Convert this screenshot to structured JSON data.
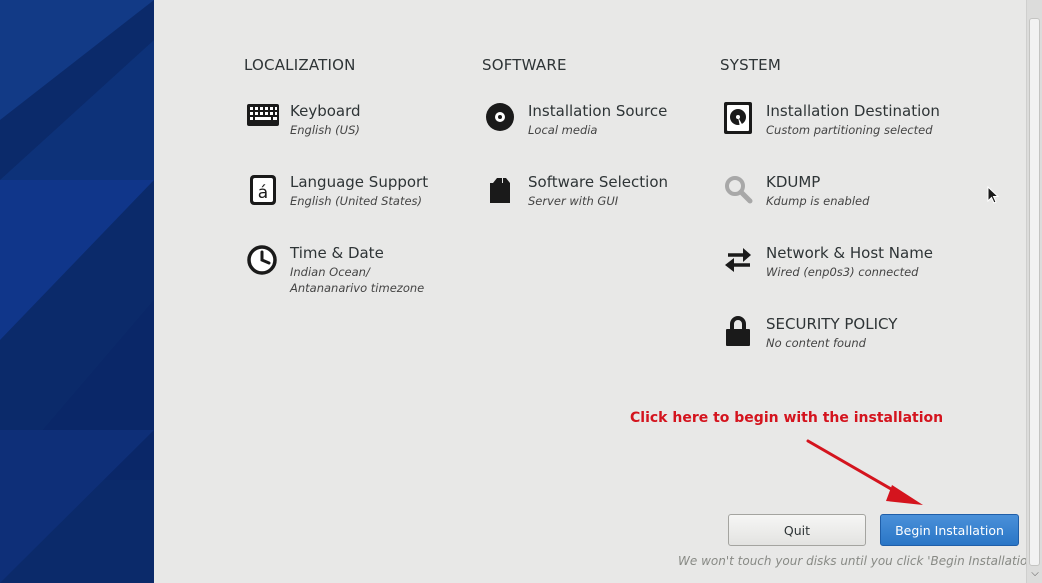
{
  "columns": {
    "localization": {
      "title": "LOCALIZATION",
      "items": [
        {
          "title": "Keyboard",
          "status": "English (US)",
          "icon": "keyboard-icon"
        },
        {
          "title": "Language Support",
          "status": "English (United States)",
          "icon": "language-icon"
        },
        {
          "title": "Time & Date",
          "status_line1": "Indian Ocean/",
          "status_line2": "Antananarivo timezone",
          "icon": "clock-icon"
        }
      ]
    },
    "software": {
      "title": "SOFTWARE",
      "items": [
        {
          "title": "Installation Source",
          "status": "Local media",
          "icon": "disc-icon"
        },
        {
          "title": "Software Selection",
          "status": "Server with GUI",
          "icon": "package-icon"
        }
      ]
    },
    "system": {
      "title": "SYSTEM",
      "items": [
        {
          "title": "Installation Destination",
          "status": "Custom partitioning selected",
          "icon": "harddisk-icon"
        },
        {
          "title": "KDUMP",
          "status": "Kdump is enabled",
          "icon": "search-icon"
        },
        {
          "title": "Network & Host Name",
          "status": "Wired (enp0s3) connected",
          "icon": "network-arrows-icon"
        },
        {
          "title": "SECURITY POLICY",
          "status": "No content found",
          "icon": "lock-icon"
        }
      ]
    }
  },
  "annotation": "Click here to begin with the installation",
  "buttons": {
    "quit": "Quit",
    "begin": "Begin Installation"
  },
  "footnote": "We won't touch your disks until you click 'Begin Installation'.",
  "colors": {
    "accent_blue": "#2a76c6",
    "annotation_red": "#d4141e",
    "sidebar": "#0b2a6a"
  }
}
